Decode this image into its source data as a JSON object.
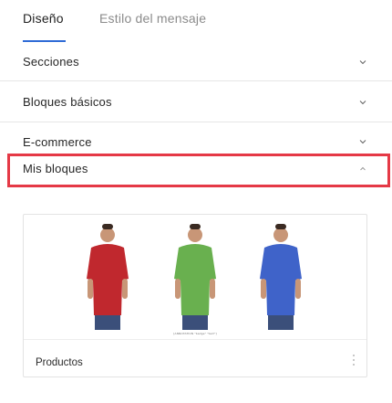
{
  "tabs": [
    {
      "label": "Diseño",
      "active": true
    },
    {
      "label": "Estilo del mensaje",
      "active": false
    }
  ],
  "sections": [
    {
      "label": "Secciones",
      "icon": "chevron-down-icon",
      "expanded": false
    },
    {
      "label": "Bloques básicos",
      "icon": "chevron-down-icon",
      "expanded": false
    },
    {
      "label": "E-commerce",
      "icon": "chevron-down-icon",
      "expanded": false
    },
    {
      "label": "Mis bloques",
      "icon": "chevron-up-icon",
      "expanded": true
    }
  ],
  "my_blocks": [
    {
      "title": "Productos",
      "caption": "[ANNOTATION \"badge\" \"text\"]",
      "menu_icon": "kebab-menu-icon",
      "shirts": [
        {
          "color": "#c0282e",
          "name": "red-shirt-icon"
        },
        {
          "color": "#69b04f",
          "name": "green-shirt-icon"
        },
        {
          "color": "#3f63c9",
          "name": "blue-shirt-icon"
        }
      ]
    }
  ],
  "colors": {
    "accent": "#2f6bd6",
    "highlight_border": "#e53946",
    "divider": "#e6e6e6"
  }
}
